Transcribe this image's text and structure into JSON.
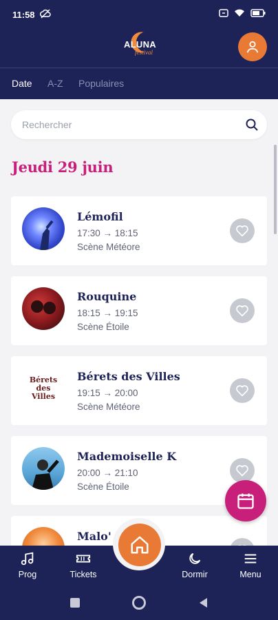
{
  "status_bar": {
    "time": "11:58"
  },
  "app": {
    "logo_text": "ALUNA",
    "logo_sub": "festival"
  },
  "tabs": [
    {
      "label": "Date",
      "active": true
    },
    {
      "label": "A-Z",
      "active": false
    },
    {
      "label": "Populaires",
      "active": false
    }
  ],
  "search": {
    "placeholder": "Rechercher"
  },
  "day": {
    "title": "Jeudi 29 juin"
  },
  "events": [
    {
      "name": "Lémofil",
      "time": "17:30 → 18:15",
      "stage": "Scène Météore",
      "thumb_color": "#3d55d6"
    },
    {
      "name": "Rouquine",
      "time": "18:15 → 19:15",
      "stage": "Scène Étoile",
      "thumb_color": "#b1262a"
    },
    {
      "name": "Bérets des Villes",
      "time": "19:15 → 20:00",
      "stage": "Scène Météore",
      "thumb_text": "Bérets des Villes"
    },
    {
      "name": "Mademoiselle K",
      "time": "20:00 → 21:10",
      "stage": "Scène Étoile",
      "thumb_color": "#5aa7d8"
    },
    {
      "name": "Malo'",
      "time": "",
      "stage": "",
      "thumb_color": "#f08a3c"
    }
  ],
  "nav": {
    "prog": "Prog",
    "tickets": "Tickets",
    "dormir": "Dormir",
    "menu": "Menu"
  },
  "colors": {
    "navy": "#1e2357",
    "orange": "#e97a35",
    "magenta": "#c81f7b"
  }
}
